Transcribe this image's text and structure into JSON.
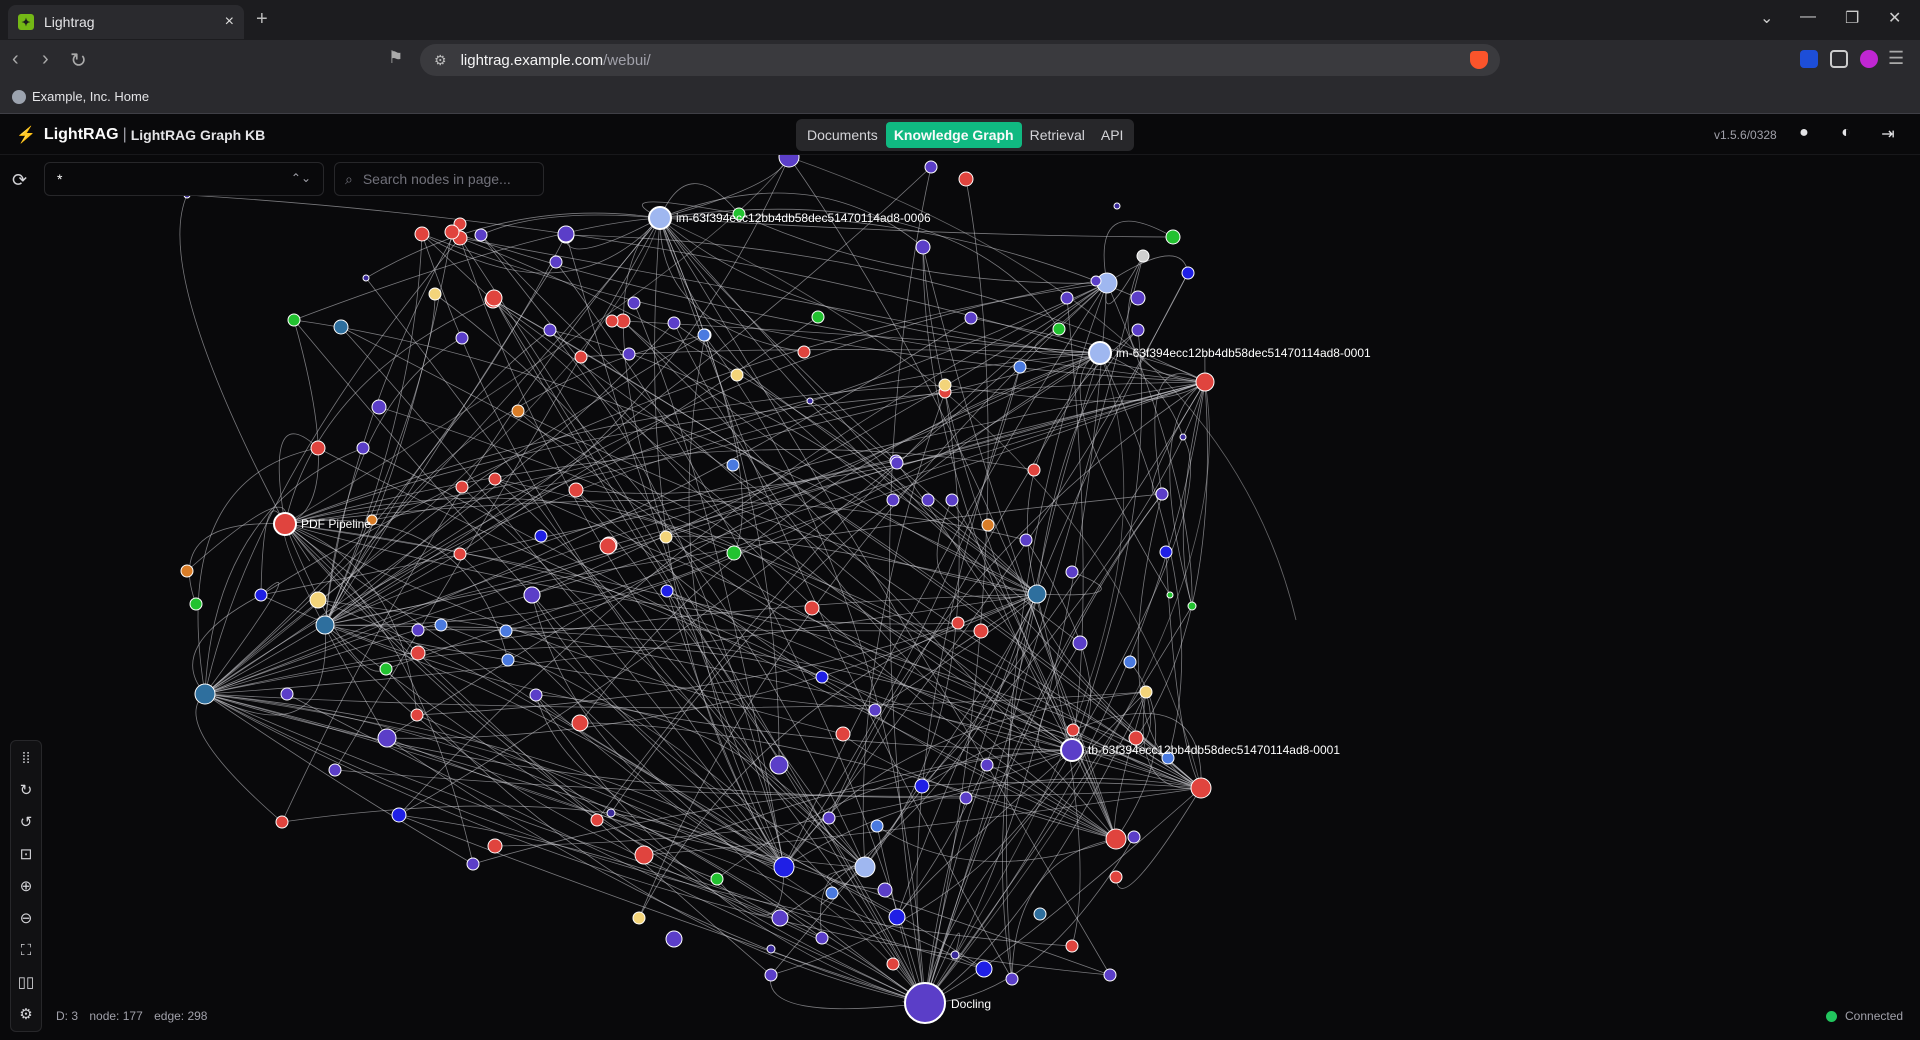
{
  "browser": {
    "tab_title": "Lightrag",
    "tab_close": "×",
    "new_tab": "+",
    "url_host": "lightrag.example.com",
    "url_path": "/webui/",
    "bookmark": "Example, Inc. Home",
    "icons": [
      "back-icon",
      "forward-icon",
      "reload-icon",
      "bookmark-icon",
      "site-settings-icon",
      "brave-shield-icon",
      "bitwarden-icon",
      "extensions-icon",
      "profile-icon",
      "menu-icon"
    ]
  },
  "app": {
    "brand": "LightRAG",
    "separator": "|",
    "kb_name": "LightRAG Graph KB",
    "tabs": [
      {
        "label": "Documents",
        "active": false
      },
      {
        "label": "Knowledge Graph",
        "active": true
      },
      {
        "label": "Retrieval",
        "active": false
      },
      {
        "label": "API",
        "active": false
      }
    ],
    "version": "v1.5.6/0328",
    "accent": "#10b981"
  },
  "graph_controls": {
    "label_value": "*",
    "search_placeholder": "Search nodes in page..."
  },
  "sidebar_tools": [
    "layout-icon",
    "rotate-cw-icon",
    "rotate-ccw-icon",
    "fit-view-icon",
    "zoom-in-icon",
    "zoom-out-icon",
    "fullscreen-icon",
    "legend-icon",
    "settings-icon"
  ],
  "stats": {
    "depth": "D: 3",
    "nodes": "node: 177",
    "edges": "edge: 298"
  },
  "status": {
    "text": "Connected",
    "color": "#22c55e"
  },
  "node_labels": {
    "im6": "im-63f394ecc12bb4db58dec51470114ad8-0006",
    "im1": "im-63f394ecc12bb4db58dec51470114ad8-0001",
    "pdf": "PDF Pipeline",
    "tb1": "tb-63f394ecc12bb4db58dec51470114ad8-0001",
    "docling": "Docling"
  }
}
